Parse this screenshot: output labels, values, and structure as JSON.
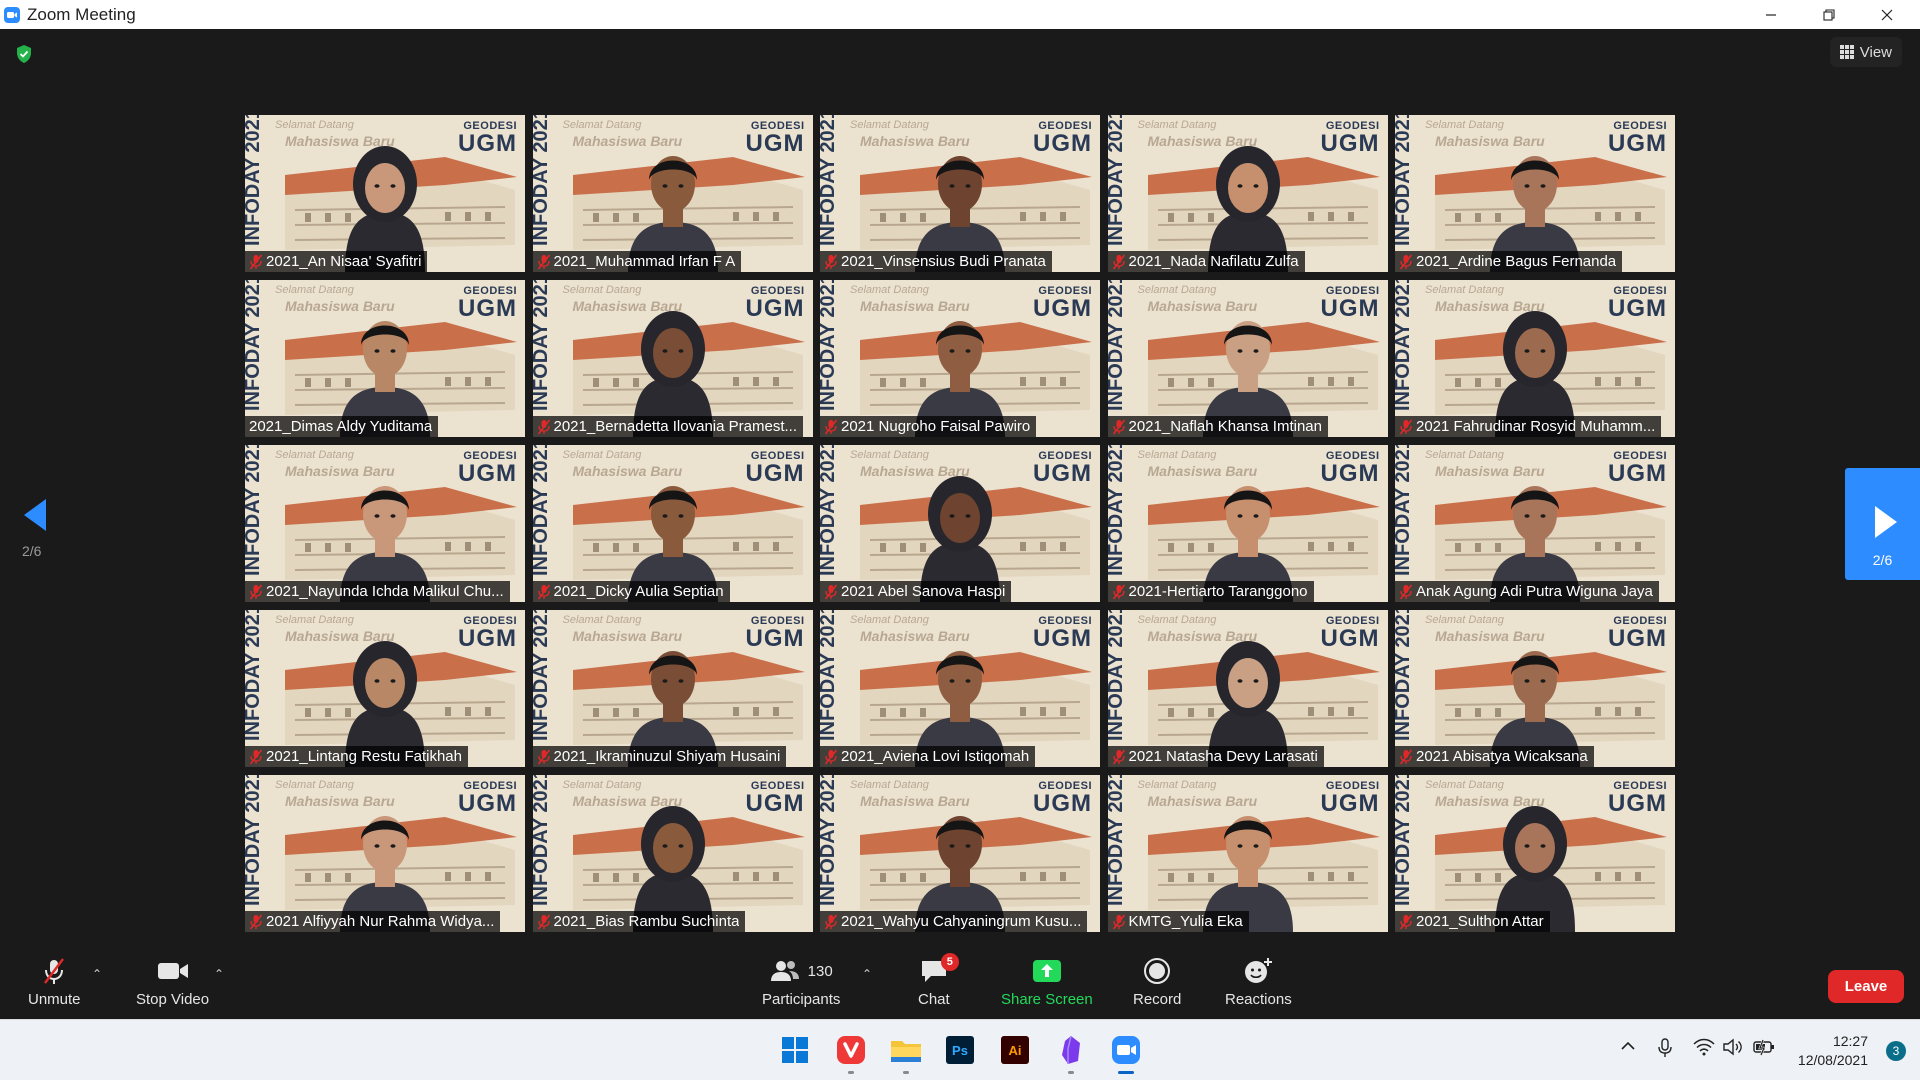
{
  "window": {
    "title": "Zoom Meeting"
  },
  "header": {
    "view_label": "View"
  },
  "pagination": {
    "left_page": "2/6",
    "right_page": "2/6"
  },
  "tile_branding": {
    "dept": "GEODESI",
    "univ": "UGM",
    "welcome_line1": "Selamat Datang",
    "welcome_line2": "Mahasiswa Baru",
    "infoday": "INFODAY 2021"
  },
  "participants": [
    {
      "name": "2021_An Nisaa' Syafitri",
      "muted": true
    },
    {
      "name": "2021_Muhammad Irfan F A",
      "muted": true
    },
    {
      "name": "2021_Vinsensius Budi Pranata",
      "muted": true
    },
    {
      "name": "2021_Nada Nafilatu Zulfa",
      "muted": true
    },
    {
      "name": "2021_Ardine Bagus Fernanda",
      "muted": true
    },
    {
      "name": "2021_Dimas Aldy Yuditama",
      "muted": false
    },
    {
      "name": "2021_Bernadetta Ilovania Pramest...",
      "muted": true
    },
    {
      "name": "2021 Nugroho Faisal Pawiro",
      "muted": true
    },
    {
      "name": "2021_Naflah Khansa Imtinan",
      "muted": true
    },
    {
      "name": "2021 Fahrudinar Rosyid Muhamm...",
      "muted": true
    },
    {
      "name": "2021_Nayunda Ichda Malikul Chu...",
      "muted": true
    },
    {
      "name": "2021_Dicky Aulia Septian",
      "muted": true
    },
    {
      "name": "2021 Abel Sanova Haspi",
      "muted": true
    },
    {
      "name": "2021-Hertiarto Taranggono",
      "muted": true
    },
    {
      "name": "Anak Agung Adi Putra Wiguna Jaya",
      "muted": true
    },
    {
      "name": "2021_Lintang Restu Fatikhah",
      "muted": true
    },
    {
      "name": "2021_Ikraminuzul Shiyam Husaini",
      "muted": true
    },
    {
      "name": "2021_Aviena Lovi Istiqomah",
      "muted": true
    },
    {
      "name": "2021 Natasha Devy Larasati",
      "muted": true
    },
    {
      "name": "2021 Abisatya Wicaksana",
      "muted": true
    },
    {
      "name": "2021 Alfiyyah Nur Rahma Widya...",
      "muted": true
    },
    {
      "name": "2021_Bias Rambu Suchinta",
      "muted": true
    },
    {
      "name": "2021_Wahyu Cahyaningrum Kusu...",
      "muted": true
    },
    {
      "name": "KMTG_Yulia Eka",
      "muted": true
    },
    {
      "name": "2021_Sulthon Attar",
      "muted": true
    }
  ],
  "toolbar": {
    "unmute": "Unmute",
    "stop_video": "Stop Video",
    "participants": "Participants",
    "participants_count": "130",
    "chat": "Chat",
    "chat_badge": "5",
    "share_screen": "Share Screen",
    "record": "Record",
    "reactions": "Reactions",
    "leave": "Leave"
  },
  "taskbar": {
    "time": "12:27",
    "date": "12/08/2021",
    "notifications": "3",
    "photoshop_label": "Ps",
    "illustrator_label": "Ai"
  },
  "colors": {
    "zoom_blue": "#2d8cff",
    "leave_red": "#e02828",
    "share_green": "#23d959"
  }
}
